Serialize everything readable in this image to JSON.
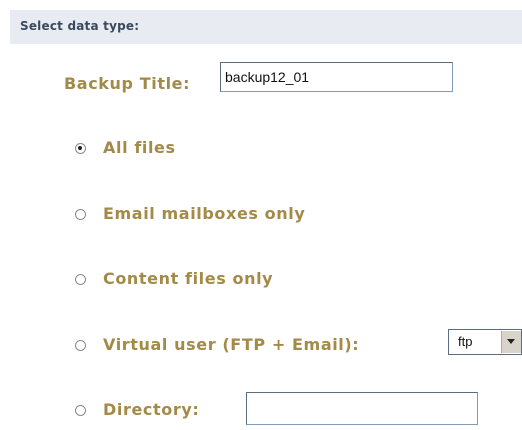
{
  "header": {
    "title": "Select data type:"
  },
  "backup_title": {
    "label": "Backup Title:",
    "value": "backup12_01"
  },
  "options": [
    {
      "label": "All files",
      "selected": true
    },
    {
      "label": "Email mailboxes only",
      "selected": false
    },
    {
      "label": "Content files only",
      "selected": false
    },
    {
      "label": "Virtual user (FTP + Email):",
      "selected": false
    },
    {
      "label": "Directory:",
      "selected": false
    }
  ],
  "virtual_user_select": {
    "value": "ftp",
    "icon": "chevron-down-icon"
  },
  "directory_input": {
    "value": ""
  },
  "colors": {
    "header_bg": "#e8ecf2",
    "header_text": "#3a4a5e",
    "label_text": "#a38a48"
  }
}
